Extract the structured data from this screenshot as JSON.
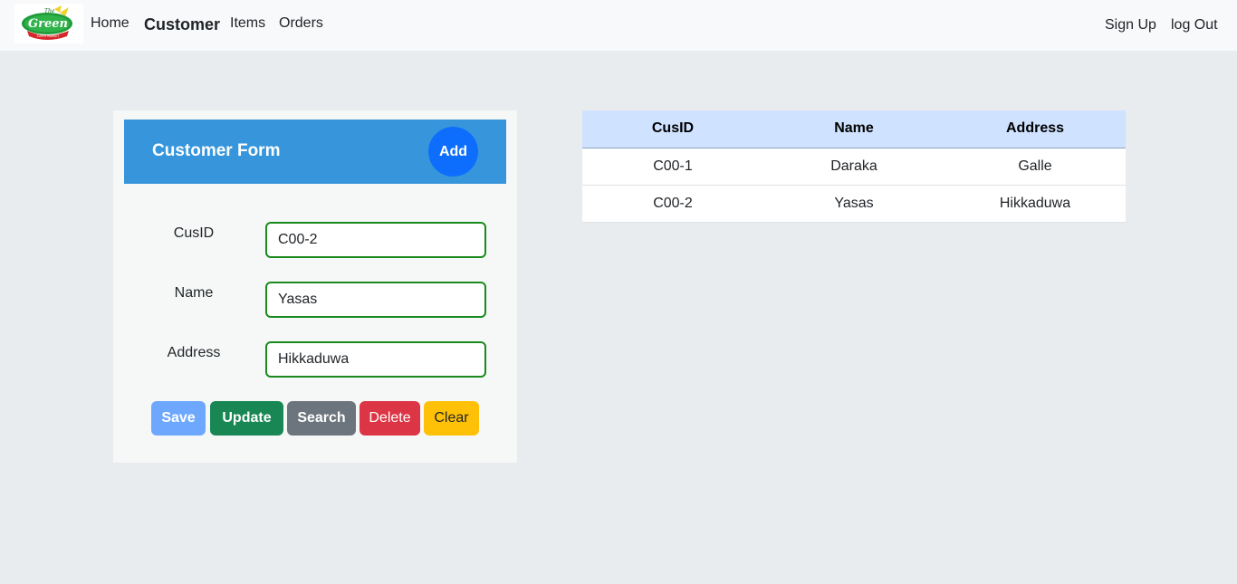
{
  "brand": {
    "logo_text_top": "The",
    "logo_text_main": "Green",
    "logo_text_sub": "SUPER MARKET",
    "colors": {
      "green": "#1f9a3a",
      "red": "#d7262b",
      "yellow": "#f0d22a"
    }
  },
  "nav": {
    "home": "Home",
    "customer": "Customer",
    "items": "Items",
    "orders": "Orders",
    "sign_up": "Sign Up",
    "log_out": "log Out"
  },
  "form": {
    "title": "Customer Form",
    "add_label": "Add",
    "fields": [
      {
        "label": "CusID",
        "value": "C00-2"
      },
      {
        "label": "Name",
        "value": "Yasas"
      },
      {
        "label": "Address",
        "value": "Hikkaduwa"
      }
    ],
    "buttons": {
      "save": "Save",
      "update": "Update",
      "search": "Search",
      "delete": "Delete",
      "clear": "Clear"
    }
  },
  "table": {
    "headers": [
      "CusID",
      "Name",
      "Address"
    ],
    "rows": [
      [
        "C00-1",
        "Daraka",
        "Galle"
      ],
      [
        "C00-2",
        "Yasas",
        "Hikkaduwa"
      ]
    ]
  }
}
